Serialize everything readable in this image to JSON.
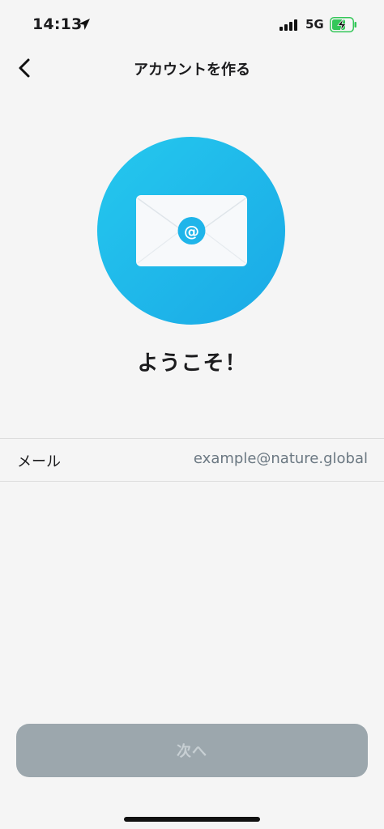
{
  "status_bar": {
    "time": "14:13",
    "network": "5G",
    "icons": [
      "location-arrow-icon",
      "signal-icon",
      "battery-charging-icon"
    ]
  },
  "nav": {
    "title": "アカウントを作る",
    "back_icon": "chevron-left-icon"
  },
  "hero": {
    "icon": "envelope-at-icon",
    "heading": "ようこそ！"
  },
  "email_row": {
    "label": "メール",
    "value": "example@nature.global"
  },
  "footer": {
    "next_label": "次へ"
  },
  "colors": {
    "accent": "#1fb5ea",
    "button_disabled": "#9ca7ad",
    "battery_green": "#34c759"
  }
}
